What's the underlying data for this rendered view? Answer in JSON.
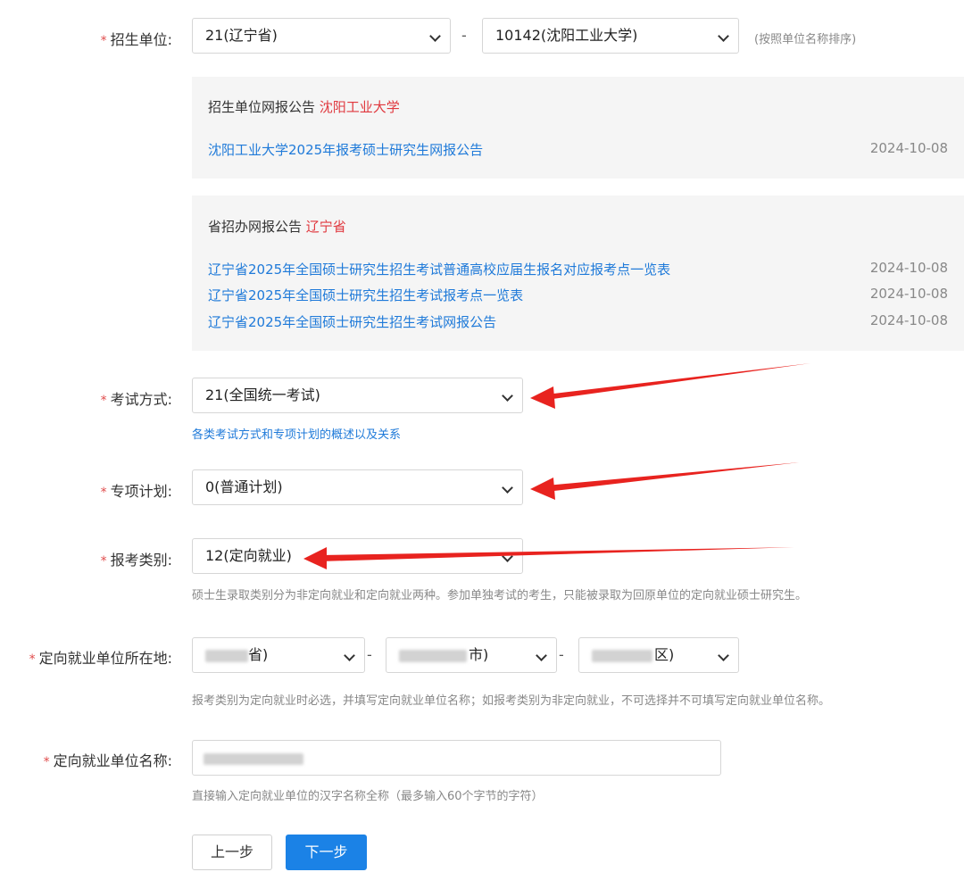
{
  "required_mark": "*",
  "separator": "-",
  "unit": {
    "label": "招生单位:",
    "province_value": "21(辽宁省)",
    "school_value": "10142(沈阳工业大学)",
    "sort_hint": "(按照单位名称排序)"
  },
  "school_notice": {
    "title_prefix": "招生单位网报公告",
    "title_highlight": "沈阳工业大学",
    "items": [
      {
        "text": "沈阳工业大学2025年报考硕士研究生网报公告",
        "date": "2024-10-08"
      }
    ]
  },
  "province_notice": {
    "title_prefix": "省招办网报公告",
    "title_highlight": "辽宁省",
    "items": [
      {
        "text": "辽宁省2025年全国硕士研究生招生考试普通高校应届生报名对应报考点一览表",
        "date": "2024-10-08"
      },
      {
        "text": "辽宁省2025年全国硕士研究生招生考试报考点一览表",
        "date": "2024-10-08"
      },
      {
        "text": "辽宁省2025年全国硕士研究生招生考试网报公告",
        "date": "2024-10-08"
      }
    ]
  },
  "exam_mode": {
    "label": "考试方式:",
    "value": "21(全国统一考试)",
    "help_link": "各类考试方式和专项计划的概述以及关系"
  },
  "special_plan": {
    "label": "专项计划:",
    "value": "0(普通计划)"
  },
  "category": {
    "label": "报考类别:",
    "value": "12(定向就业)",
    "hint": "硕士生录取类别分为非定向就业和定向就业两种。参加单独考试的考生，只能被录取为回原单位的定向就业硕士研究生。"
  },
  "employer_location": {
    "label": "定向就业单位所在地:",
    "province_partial": "省)",
    "city_partial": "市)",
    "district_partial": "区)",
    "hint": "报考类别为定向就业时必选，并填写定向就业单位名称；如报考类别为非定向就业，不可选择并不可填写定向就业单位名称。"
  },
  "employer_name": {
    "label": "定向就业单位名称:",
    "hint": "直接输入定向就业单位的汉字名称全称（最多输入60个字节的字符）"
  },
  "buttons": {
    "prev": "上一步",
    "next": "下一步"
  },
  "colors": {
    "link": "#1f7ad9",
    "required": "#e04b4b",
    "highlight": "#e0383e",
    "primary_button": "#1b82e6",
    "annotation_arrow": "#e8231f"
  }
}
